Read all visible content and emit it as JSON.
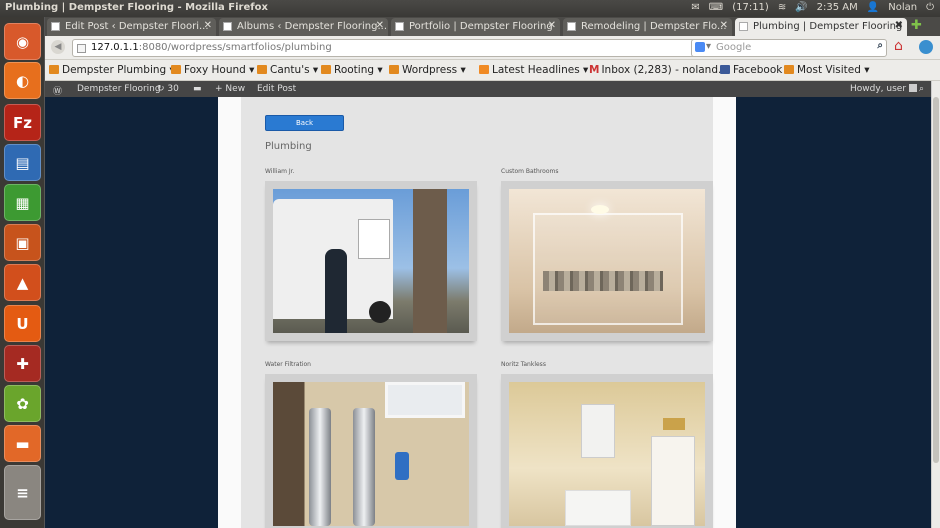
{
  "system_bar": {
    "window_title": "Plumbing | Dempster Flooring - Mozilla Firefox",
    "battery": "(17:11)",
    "clock": "2:35 AM",
    "user": "Nolan"
  },
  "tabs": [
    {
      "label": "Edit Post ‹ Dempster Floori..."
    },
    {
      "label": "Albums ‹ Dempster Flooring..."
    },
    {
      "label": "Portfolio | Dempster Flooring"
    },
    {
      "label": "Remodeling | Dempster Flo..."
    },
    {
      "label": "Plumbing | Dempster Flooring",
      "active": true
    }
  ],
  "nav": {
    "url_host": "127.0.1.1",
    "url_rest": ":8080/wordpress/smartfolios/plumbing",
    "search_placeholder": "Google"
  },
  "bookmarks": [
    {
      "label": "Dempster Plumbing",
      "arrow": "▾"
    },
    {
      "label": "Foxy Hound",
      "arrow": "▾"
    },
    {
      "label": "Cantu's",
      "arrow": "▾"
    },
    {
      "label": "Rooting",
      "arrow": "▾"
    },
    {
      "label": "Wordpress",
      "arrow": "▾"
    },
    {
      "label": "Latest Headlines",
      "arrow": "▾"
    },
    {
      "label": "Inbox (2,283) - noland...",
      "arrow": ""
    },
    {
      "label": "Facebook",
      "arrow": ""
    },
    {
      "label": "Most Visited",
      "arrow": "▾"
    }
  ],
  "wp_admin_bar": {
    "site": "Dempster Flooring",
    "updates": "30",
    "new": "New",
    "edit": "Edit Post",
    "howdy": "Howdy, user"
  },
  "gallery": {
    "back_label": "Back",
    "title": "Plumbing",
    "items": [
      {
        "caption": "William Jr."
      },
      {
        "caption": "Custom Bathrooms"
      },
      {
        "caption": "Water Filtration"
      },
      {
        "caption": "Noritz Tankless"
      }
    ]
  },
  "colors": {
    "desktop_bg": "#0f2239",
    "accent_button": "#2a7ad2"
  }
}
